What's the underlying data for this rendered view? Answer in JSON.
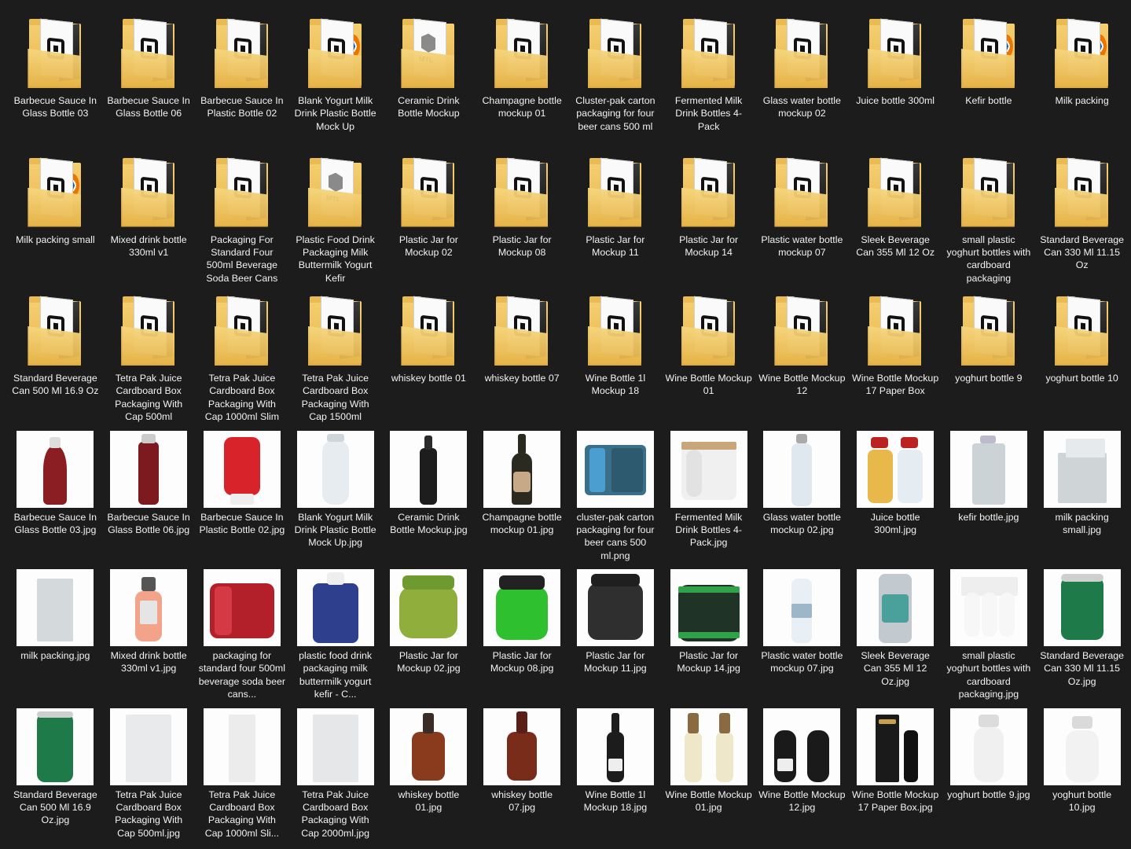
{
  "items": [
    {
      "label": "Barbecue Sauce In Glass Bottle 03",
      "type": "folder",
      "variant": "dark"
    },
    {
      "label": "Barbecue Sauce In Glass Bottle 06",
      "type": "folder",
      "variant": "dark"
    },
    {
      "label": "Barbecue Sauce In Plastic Bottle 02",
      "type": "folder",
      "variant": "dark"
    },
    {
      "label": "Blank Yogurt Milk Drink Plastic Bottle Mock Up",
      "type": "folder",
      "variant": "blender"
    },
    {
      "label": "Ceramic Drink Bottle Mockup",
      "type": "folder",
      "variant": "mtl"
    },
    {
      "label": "Champagne bottle mockup 01",
      "type": "folder",
      "variant": "dark"
    },
    {
      "label": "Cluster-pak carton packaging for four beer cans 500 ml",
      "type": "folder",
      "variant": "dark"
    },
    {
      "label": "Fermented Milk Drink Bottles 4-Pack",
      "type": "folder",
      "variant": "dark"
    },
    {
      "label": "Glass water bottle mockup 02",
      "type": "folder",
      "variant": "dark"
    },
    {
      "label": "Juice bottle 300ml",
      "type": "folder",
      "variant": "dark"
    },
    {
      "label": "Kefir bottle",
      "type": "folder",
      "variant": "blender"
    },
    {
      "label": "Milk packing",
      "type": "folder",
      "variant": "blender"
    },
    {
      "label": "Milk packing small",
      "type": "folder",
      "variant": "blender"
    },
    {
      "label": "Mixed drink bottle 330ml v1",
      "type": "folder",
      "variant": "dark"
    },
    {
      "label": "Packaging For Standard Four 500ml Beverage Soda Beer Cans",
      "type": "folder",
      "variant": "dark"
    },
    {
      "label": "Plastic Food Drink Packaging Milk Buttermilk Yogurt Kefir",
      "type": "folder",
      "variant": "mtl"
    },
    {
      "label": "Plastic Jar for Mockup 02",
      "type": "folder",
      "variant": "dark"
    },
    {
      "label": "Plastic Jar for Mockup 08",
      "type": "folder",
      "variant": "dark"
    },
    {
      "label": "Plastic Jar for Mockup 11",
      "type": "folder",
      "variant": "dark"
    },
    {
      "label": "Plastic Jar for Mockup 14",
      "type": "folder",
      "variant": "dark"
    },
    {
      "label": "Plastic water bottle mockup 07",
      "type": "folder",
      "variant": "dark"
    },
    {
      "label": "Sleek Beverage Can 355 Ml 12 Oz",
      "type": "folder",
      "variant": "dark"
    },
    {
      "label": "small plastic yoghurt bottles with cardboard packaging",
      "type": "folder",
      "variant": "dark"
    },
    {
      "label": "Standard Beverage Can 330 Ml 11.15 Oz",
      "type": "folder",
      "variant": "dark"
    },
    {
      "label": "Standard Beverage Can 500 Ml 16.9 Oz",
      "type": "folder",
      "variant": "dark"
    },
    {
      "label": "Tetra Pak Juice Cardboard Box Packaging With Cap 500ml",
      "type": "folder",
      "variant": "dark"
    },
    {
      "label": "Tetra Pak Juice Cardboard Box Packaging With Cap 1000ml Slim",
      "type": "folder",
      "variant": "dark"
    },
    {
      "label": "Tetra Pak Juice Cardboard Box Packaging With Cap 1500ml",
      "type": "folder",
      "variant": "dark"
    },
    {
      "label": "whiskey bottle 01",
      "type": "folder",
      "variant": "dark"
    },
    {
      "label": "whiskey bottle 07",
      "type": "folder",
      "variant": "dark"
    },
    {
      "label": "Wine Bottle 1l Mockup 18",
      "type": "folder",
      "variant": "dark"
    },
    {
      "label": "Wine Bottle Mockup 01",
      "type": "folder",
      "variant": "dark"
    },
    {
      "label": "Wine Bottle Mockup 12",
      "type": "folder",
      "variant": "dark"
    },
    {
      "label": "Wine Bottle Mockup 17 Paper Box",
      "type": "folder",
      "variant": "dark"
    },
    {
      "label": "yoghurt bottle 9",
      "type": "folder",
      "variant": "dark"
    },
    {
      "label": "yoghurt bottle 10",
      "type": "folder",
      "variant": "dark"
    },
    {
      "label": "Barbecue Sauce In Glass Bottle 03.jpg",
      "type": "image",
      "thumb": "bottle-red"
    },
    {
      "label": "Barbecue Sauce In Glass Bottle 06.jpg",
      "type": "image",
      "thumb": "bottle-red-slim"
    },
    {
      "label": "Barbecue Sauce In Plastic Bottle 02.jpg",
      "type": "image",
      "thumb": "squeeze-red"
    },
    {
      "label": "Blank Yogurt Milk Drink Plastic Bottle Mock Up.jpg",
      "type": "image",
      "thumb": "bottle-white"
    },
    {
      "label": "Ceramic Drink Bottle Mockup.jpg",
      "type": "image",
      "thumb": "bottle-black"
    },
    {
      "label": "Champagne bottle mockup 01.jpg",
      "type": "image",
      "thumb": "champagne"
    },
    {
      "label": "cluster-pak carton packaging for four beer cans 500 ml.png",
      "type": "image",
      "thumb": "cluster"
    },
    {
      "label": "Fermented Milk Drink Bottles 4-Pack.jpg",
      "type": "image",
      "thumb": "pack-white"
    },
    {
      "label": "Glass water bottle mockup 02.jpg",
      "type": "image",
      "thumb": "bottle-glass"
    },
    {
      "label": "Juice bottle 300ml.jpg",
      "type": "image",
      "thumb": "juice"
    },
    {
      "label": "kefir bottle.jpg",
      "type": "image",
      "thumb": "kefir"
    },
    {
      "label": "milk packing small.jpg",
      "type": "image",
      "thumb": "carton"
    },
    {
      "label": "milk packing.jpg",
      "type": "image",
      "thumb": "carton-tall"
    },
    {
      "label": "Mixed drink bottle 330ml v1.jpg",
      "type": "image",
      "thumb": "mixed"
    },
    {
      "label": "packaging for standard four 500ml beverage soda beer cans...",
      "type": "image",
      "thumb": "cans-red"
    },
    {
      "label": "plastic food drink packaging milk buttermilk yogurt kefir - C...",
      "type": "image",
      "thumb": "jug-blue"
    },
    {
      "label": "Plastic Jar for Mockup 02.jpg",
      "type": "image",
      "thumb": "jar-green"
    },
    {
      "label": "Plastic Jar for Mockup 08.jpg",
      "type": "image",
      "thumb": "jar-brightgreen"
    },
    {
      "label": "Plastic Jar for Mockup 11.jpg",
      "type": "image",
      "thumb": "jar-black"
    },
    {
      "label": "Plastic Jar for Mockup 14.jpg",
      "type": "image",
      "thumb": "jar-blackgreen"
    },
    {
      "label": "Plastic water bottle mockup 07.jpg",
      "type": "image",
      "thumb": "water"
    },
    {
      "label": "Sleek Beverage Can 355 Ml 12 Oz.jpg",
      "type": "image",
      "thumb": "can-silver"
    },
    {
      "label": "small plastic yoghurt bottles with cardboard packaging.jpg",
      "type": "image",
      "thumb": "yoghurt-pack"
    },
    {
      "label": "Standard Beverage Can 330 Ml 11.15 Oz.jpg",
      "type": "image",
      "thumb": "can-green"
    },
    {
      "label": "Standard Beverage Can 500 Ml 16.9 Oz.jpg",
      "type": "image",
      "thumb": "can-green-tall"
    },
    {
      "label": "Tetra Pak Juice Cardboard Box Packaging With Cap 500ml.jpg",
      "type": "image",
      "thumb": "tetra"
    },
    {
      "label": "Tetra Pak Juice Cardboard Box Packaging With Cap 1000ml Sli...",
      "type": "image",
      "thumb": "tetra-slim"
    },
    {
      "label": "Tetra Pak Juice Cardboard Box Packaging With Cap 2000ml.jpg",
      "type": "image",
      "thumb": "tetra-big"
    },
    {
      "label": "whiskey bottle 01.jpg",
      "type": "image",
      "thumb": "whiskey"
    },
    {
      "label": "whiskey bottle 07.jpg",
      "type": "image",
      "thumb": "whiskey2"
    },
    {
      "label": "Wine Bottle 1l Mockup 18.jpg",
      "type": "image",
      "thumb": "wine-black"
    },
    {
      "label": "Wine Bottle Mockup 01.jpg",
      "type": "image",
      "thumb": "wine-white"
    },
    {
      "label": "Wine Bottle Mockup 12.jpg",
      "type": "image",
      "thumb": "wine-black2"
    },
    {
      "label": "Wine Bottle Mockup 17 Paper Box.jpg",
      "type": "image",
      "thumb": "wine-box"
    },
    {
      "label": "yoghurt bottle 9.jpg",
      "type": "image",
      "thumb": "yoghurt"
    },
    {
      "label": "yoghurt bottle 10.jpg",
      "type": "image",
      "thumb": "yoghurt2"
    }
  ]
}
